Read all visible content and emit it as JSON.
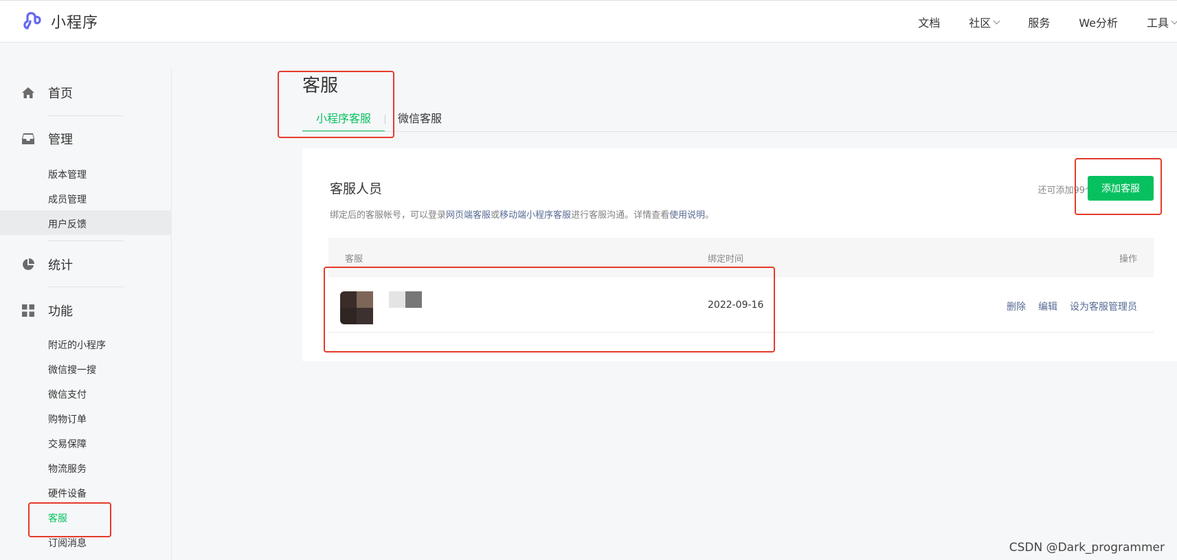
{
  "header": {
    "logo_text": "小程序",
    "nav": [
      {
        "label": "文档",
        "has_dropdown": false
      },
      {
        "label": "社区",
        "has_dropdown": true
      },
      {
        "label": "服务",
        "has_dropdown": false
      },
      {
        "label": "We分析",
        "has_dropdown": false
      },
      {
        "label": "工具",
        "has_dropdown": true
      }
    ]
  },
  "sidebar": {
    "home": {
      "label": "首页",
      "icon": "home-icon"
    },
    "manage": {
      "label": "管理",
      "icon": "inbox-icon",
      "items": [
        "版本管理",
        "成员管理",
        "用户反馈"
      ]
    },
    "stats": {
      "label": "统计",
      "icon": "pie-chart-icon"
    },
    "features": {
      "label": "功能",
      "icon": "grid-icon",
      "items": [
        "附近的小程序",
        "微信搜一搜",
        "微信支付",
        "购物订单",
        "交易保障",
        "物流服务",
        "硬件设备",
        "客服",
        "订阅消息"
      ]
    },
    "active_item": "客服",
    "hovered_item": "用户反馈"
  },
  "main": {
    "title": "客服",
    "tabs": [
      {
        "label": "小程序客服",
        "active": true
      },
      {
        "label": "微信客服",
        "active": false
      }
    ],
    "card": {
      "title": "客服人员",
      "desc": {
        "pre": "绑定后的客服帐号，可以登录",
        "link1": "网页端客服",
        "mid1": "或",
        "link2": "移动端小程序客服",
        "mid2": "进行客服沟通。详情查看",
        "link3": "使用说明",
        "post": "。"
      },
      "quota": "还可添加99个",
      "add_button": "添加客服",
      "columns": {
        "agent": "客服",
        "bind_time": "绑定时间",
        "actions": "操作"
      },
      "rows": [
        {
          "bind_time": "2022-09-16",
          "actions": [
            "删除",
            "编辑",
            "设为客服管理员"
          ]
        }
      ]
    }
  },
  "watermark": "CSDN @Dark_programmer",
  "colors": {
    "accent_green": "#07c160",
    "link_blue": "#576b95",
    "annotation_red": "#e53a2a"
  }
}
